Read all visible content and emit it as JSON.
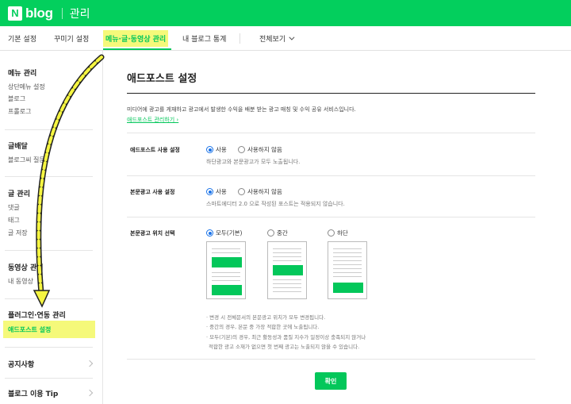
{
  "header": {
    "logo_n": "N",
    "logo_text": "blog",
    "section": "관리"
  },
  "tabs": [
    {
      "label": "기본 설정"
    },
    {
      "label": "꾸미기 설정"
    },
    {
      "label": "메뉴·글·동영상 관리"
    },
    {
      "label": "내 블로그 통계"
    },
    {
      "label": "전체보기"
    }
  ],
  "sidebar": {
    "groups": [
      {
        "title": "메뉴 관리",
        "items": [
          "상단메뉴 설정",
          "블로그",
          "프롤로그"
        ]
      },
      {
        "title": "글배달",
        "items": [
          "블로그씨 질문"
        ]
      },
      {
        "title": "글 관리",
        "items": [
          "댓글",
          "태그",
          "글 저장"
        ]
      },
      {
        "title": "동영상 관리",
        "items": [
          "내 동영상"
        ]
      },
      {
        "title": "플러그인·연동 관리",
        "items": [
          "애드포스트 설정"
        ]
      }
    ],
    "links": [
      "공지사항",
      "블로그 이용 Tip"
    ]
  },
  "main": {
    "title": "애드포스트 설정",
    "description": "미디어에 광고를 게재하고 광고에서 발생한 수익을 배분 받는 광고 매칭 및 수익 공유 서비스입니다.",
    "manage_link": "애드포스트 관리하기 ›",
    "rows": [
      {
        "label": "애드포스트 사용 설정",
        "options": [
          "사용",
          "사용하지 않음"
        ],
        "selected": 0,
        "hint": "하단광고와 본문광고가 모두 노출됩니다."
      },
      {
        "label": "본문광고 사용 설정",
        "options": [
          "사용",
          "사용하지 않음"
        ],
        "selected": 0,
        "hint": "스마트에디터 2.0 으로 작성된 포스트는 적용되지 않습니다."
      },
      {
        "label": "본문광고 위치 선택",
        "options": [
          "모두(기본)",
          "중간",
          "하단"
        ],
        "selected": 0
      }
    ],
    "notes": [
      "· 변경 시 전체문서의 본문광고 위치가 모두 변경됩니다.",
      "· 중간의 경우, 본문 중 가장 적합한 곳에 노출됩니다.",
      "· 모두(기본)의 경우, 최근 활동성과 품질 지수가 일정이상 충족되지 않거나",
      "  적합한 광고 소재가 없으면 첫 번째 광고는 노출되지 않을 수 있습니다."
    ],
    "confirm_label": "확인"
  },
  "colors": {
    "brand": "#03cf5d",
    "accent": "#03c75a",
    "highlight": "#f5f97a",
    "radio": "#1a73e8"
  }
}
